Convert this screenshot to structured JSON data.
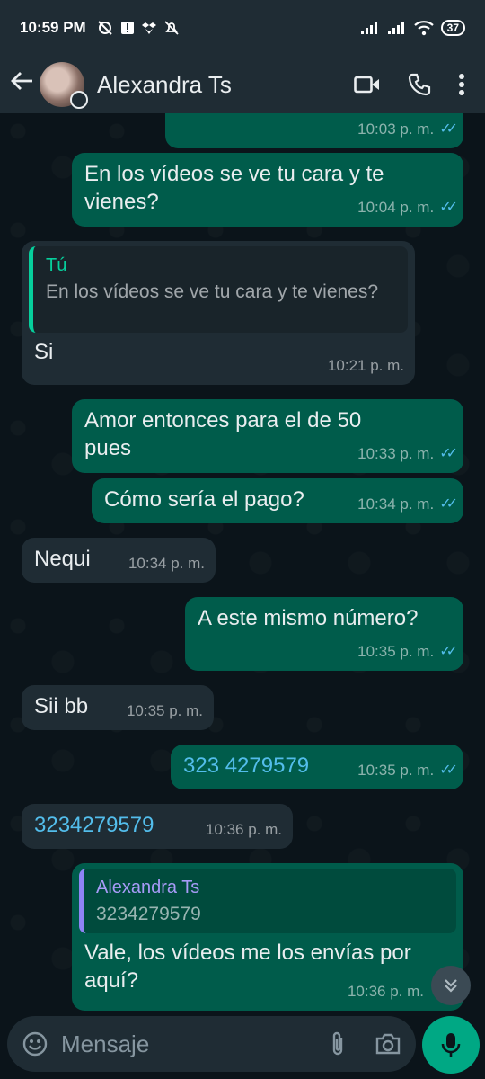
{
  "status_bar": {
    "time": "10:59 PM",
    "battery": "37"
  },
  "header": {
    "contact_name": "Alexandra Ts"
  },
  "messages": [
    {
      "time": "10:03 p. m."
    },
    {
      "text": "En los vídeos se ve tu cara y te vienes?",
      "time": "10:04 p. m."
    },
    {
      "quote_author": "Tú",
      "quote_text": "En los vídeos se ve tu cara y te vienes?",
      "text": "Si",
      "time": "10:21 p. m."
    },
    {
      "text": "Amor entonces para el de 50 pues",
      "time": "10:33 p. m."
    },
    {
      "text": "Cómo sería el pago?",
      "time": "10:34 p. m."
    },
    {
      "text": "Nequi",
      "time": "10:34 p. m."
    },
    {
      "text": "A este mismo número?",
      "time": "10:35 p. m."
    },
    {
      "text": "Sii bb",
      "time": "10:35 p. m."
    },
    {
      "text": "323 4279579",
      "time": "10:35 p. m."
    },
    {
      "text": "3234279579",
      "time": "10:36 p. m."
    },
    {
      "quote_author": "Alexandra Ts",
      "quote_text": "3234279579",
      "text": "Vale, los vídeos me los envías por aquí?",
      "time": "10:36 p. m."
    }
  ],
  "composer": {
    "placeholder": "Mensaje"
  },
  "colors": {
    "outgoing": "#005c4b",
    "incoming": "#1f2c34",
    "accent": "#00a884",
    "ticks": "#53bdeb"
  }
}
